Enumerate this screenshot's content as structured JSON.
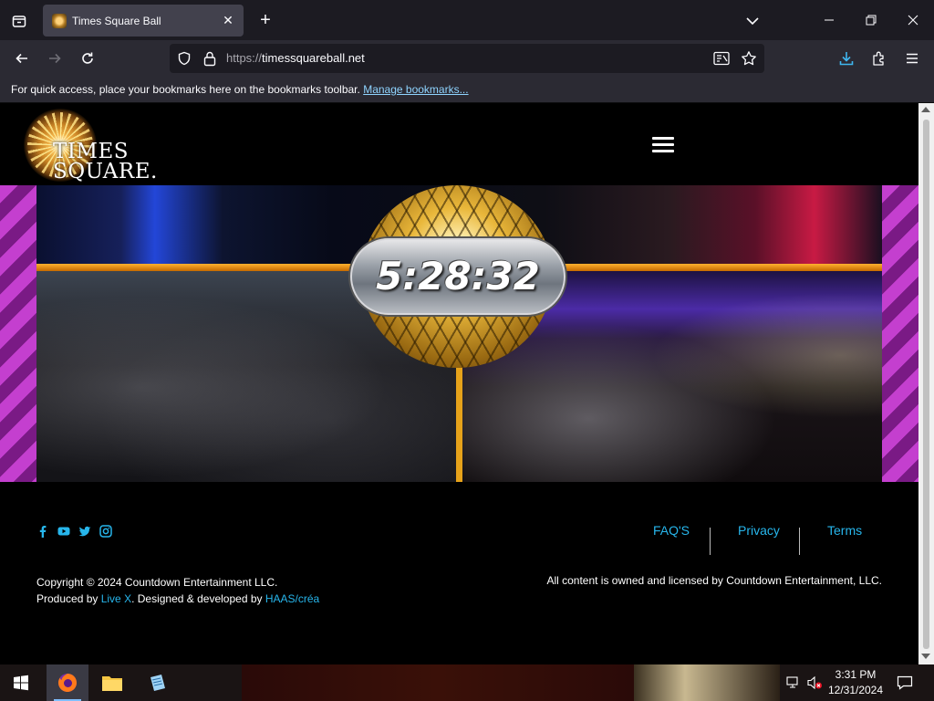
{
  "browser": {
    "tab_title": "Times Square Ball",
    "url_scheme": "https://",
    "url_host": "timessquareball.net",
    "bookmarks_hint": "For quick access, place your bookmarks here on the bookmarks toolbar.",
    "bookmarks_link": "Manage bookmarks..."
  },
  "site": {
    "logo_line1": "TIMES",
    "logo_line2": "SQUARE.",
    "countdown": "5:28:32",
    "footer": {
      "social_icons": [
        "facebook-icon",
        "youtube-icon",
        "twitter-icon",
        "instagram-icon"
      ],
      "links": [
        "FAQ'S",
        "Privacy",
        "Terms"
      ],
      "copyright_line": "Copyright © 2024 Countdown Entertainment LLC.",
      "produced_by_prefix": "Produced by ",
      "produced_by_link": "Live X",
      "designed_prefix": ". Designed & developed by ",
      "designed_link": "HAAS/créa",
      "rights": "All content is owned and licensed by Countdown Entertainment, LLC."
    }
  },
  "taskbar": {
    "time": "3:31 PM",
    "date": "12/31/2024"
  },
  "colors": {
    "link": "#27b6ec",
    "accent_orange": "#e6a21a",
    "browser_bg": "#1c1b22"
  }
}
